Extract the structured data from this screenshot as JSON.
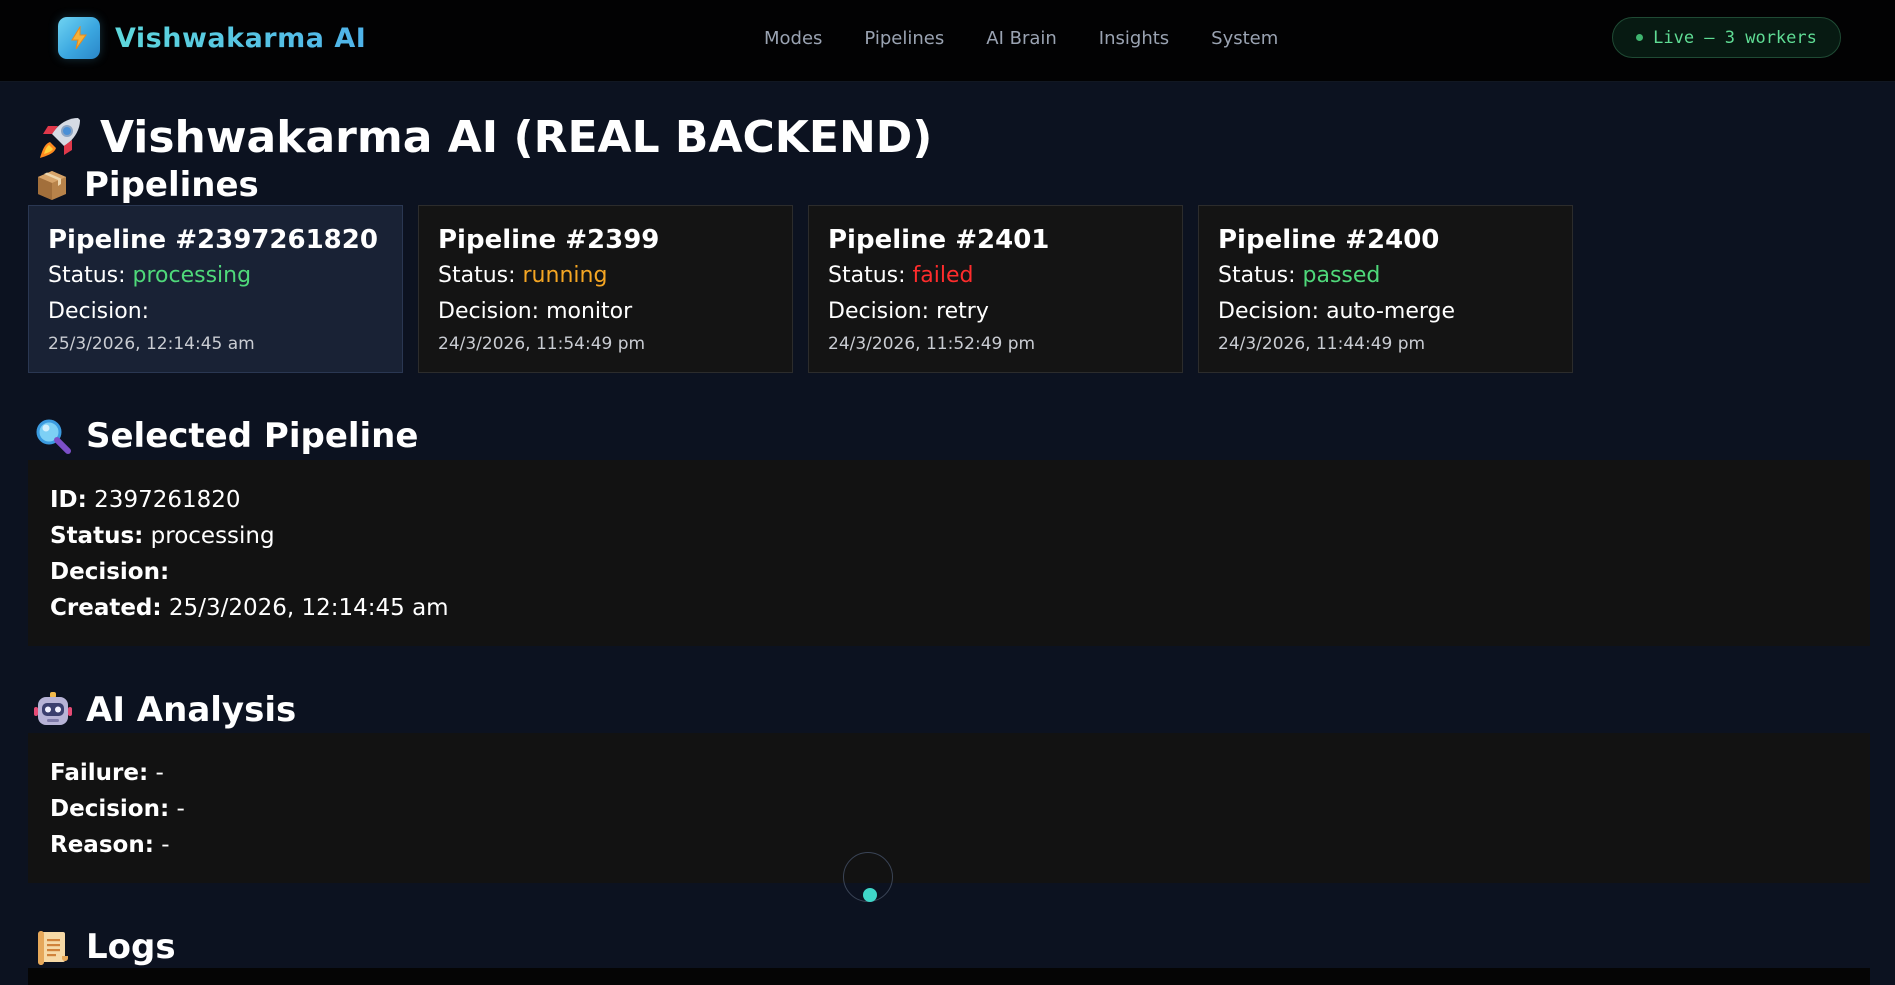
{
  "app": {
    "name": "Vishwakarma AI",
    "logo_icon": "lightning-icon"
  },
  "nav": {
    "items": [
      "Modes",
      "Pipelines",
      "AI Brain",
      "Insights",
      "System"
    ]
  },
  "status_pill": {
    "text": "Live — 3 workers",
    "color": "#5fdc94"
  },
  "page": {
    "title": "Vishwakarma AI (REAL BACKEND)",
    "title_icon": "rocket-icon"
  },
  "pipelines_section": {
    "heading": "Pipelines",
    "icon": "package-icon",
    "cards": [
      {
        "title": "Pipeline #2397261820",
        "status_label": "Status:",
        "status": "processing",
        "decision_label": "Decision:",
        "decision": "",
        "time": "25/3/2026, 12:14:45 am",
        "selected": true
      },
      {
        "title": "Pipeline #2399",
        "status_label": "Status:",
        "status": "running",
        "decision_label": "Decision:",
        "decision": "monitor",
        "time": "24/3/2026, 11:54:49 pm",
        "selected": false
      },
      {
        "title": "Pipeline #2401",
        "status_label": "Status:",
        "status": "failed",
        "decision_label": "Decision:",
        "decision": "retry",
        "time": "24/3/2026, 11:52:49 pm",
        "selected": false
      },
      {
        "title": "Pipeline #2400",
        "status_label": "Status:",
        "status": "passed",
        "decision_label": "Decision:",
        "decision": "auto-merge",
        "time": "24/3/2026, 11:44:49 pm",
        "selected": false
      }
    ],
    "status_colors": {
      "processing": "#4fd97a",
      "running": "#f5a623",
      "failed": "#ff2c2c",
      "passed": "#4fd97a"
    }
  },
  "selected_pipeline": {
    "heading": "Selected Pipeline",
    "icon": "magnifier-icon",
    "id_label": "ID:",
    "id": "2397261820",
    "status_label": "Status:",
    "status": "processing",
    "decision_label": "Decision:",
    "decision": "",
    "created_label": "Created:",
    "created": "25/3/2026, 12:14:45 am"
  },
  "ai_analysis": {
    "heading": "AI Analysis",
    "icon": "robot-icon",
    "failure_label": "Failure:",
    "failure": "-",
    "decision_label": "Decision:",
    "decision": "-",
    "reason_label": "Reason:",
    "reason": "-"
  },
  "logs": {
    "heading": "Logs",
    "icon": "scroll-icon"
  }
}
